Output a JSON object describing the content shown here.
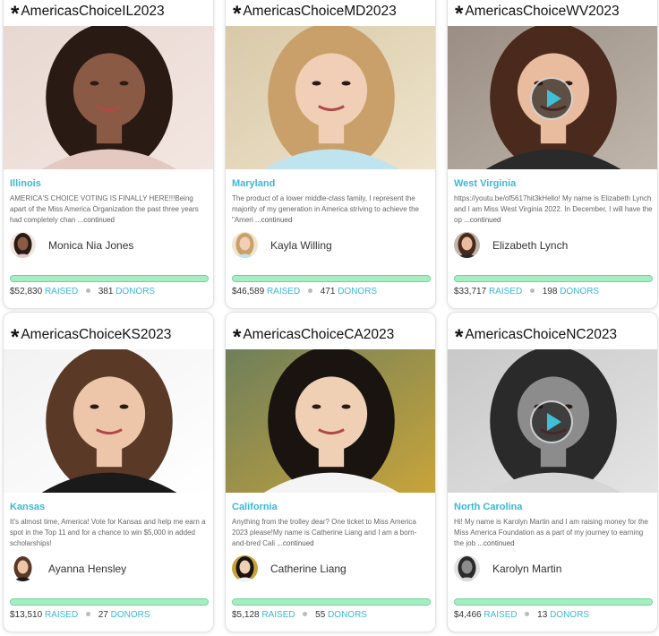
{
  "colors": {
    "accent": "#3ab8d6",
    "progress": "#a6eec2",
    "progress_border": "#6fd39a"
  },
  "cards": [
    {
      "title": "AmericasChoiceIL2023",
      "state": "Illinois",
      "description": "AMERICA'S CHOICE VOTING IS FINALLY HERE!!!Being apart of the Miss America Organization the past three years had completely chan",
      "continued": "...continued",
      "name": "Monica Nia Jones",
      "raised": "$52,830",
      "raised_label": "RAISED",
      "donors": "381",
      "donors_label": "DONORS",
      "progress": 1.0,
      "has_video": false,
      "photo_icon": "portrait-photo"
    },
    {
      "title": "AmericasChoiceMD2023",
      "state": "Maryland",
      "description": "The product of a lower middle-class family, I represent the majority of my generation in America striving to achieve the \"Ameri",
      "continued": "...continued",
      "name": "Kayla Willing",
      "raised": "$46,589",
      "raised_label": "RAISED",
      "donors": "471",
      "donors_label": "DONORS",
      "progress": 1.0,
      "has_video": false,
      "photo_icon": "portrait-photo"
    },
    {
      "title": "AmericasChoiceWV2023",
      "state": "West Virginia",
      "description": "https://youtu.be/of5617hit3kHello! My name is Elizabeth Lynch and I am Miss West Virginia 2022. In December, I will have the op",
      "continued": "...continued",
      "name": "Elizabeth Lynch",
      "raised": "$33,717",
      "raised_label": "RAISED",
      "donors": "198",
      "donors_label": "DONORS",
      "progress": 1.0,
      "has_video": true,
      "photo_icon": "portrait-photo"
    },
    {
      "title": "AmericasChoiceKS2023",
      "state": "Kansas",
      "description": "It's almost time, America! Vote for Kansas and help me earn a spot in the Top 11 and for a chance to win $5,000 in added scholarships!",
      "continued": "",
      "name": "Ayanna Hensley",
      "raised": "$13,510",
      "raised_label": "RAISED",
      "donors": "27",
      "donors_label": "DONORS",
      "progress": 1.0,
      "has_video": false,
      "photo_icon": "portrait-photo"
    },
    {
      "title": "AmericasChoiceCA2023",
      "state": "California",
      "description": "Anything from the trolley dear? One ticket to Miss America 2023 please!My name is Catherine Liang and I am a born-and-bred Cali",
      "continued": "...continued",
      "name": "Catherine Liang",
      "raised": "$5,128",
      "raised_label": "RAISED",
      "donors": "55",
      "donors_label": "DONORS",
      "progress": 1.0,
      "has_video": false,
      "photo_icon": "portrait-photo"
    },
    {
      "title": "AmericasChoiceNC2023",
      "state": "North Carolina",
      "description": "Hi! My name is Karolyn Martin and I am raising money for the Miss America Foundation as a part of my journey to earning the job",
      "continued": "...continued",
      "name": "Karolyn Martin",
      "raised": "$4,466",
      "raised_label": "RAISED",
      "donors": "13",
      "donors_label": "DONORS",
      "progress": 1.0,
      "has_video": true,
      "photo_icon": "portrait-photo"
    }
  ]
}
